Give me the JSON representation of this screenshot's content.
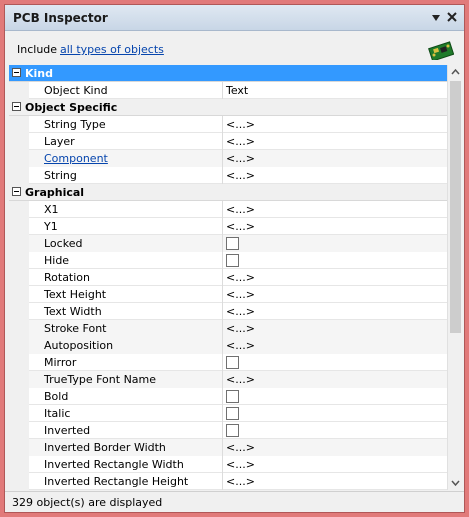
{
  "window": {
    "title": "PCB Inspector"
  },
  "include": {
    "label": "Include",
    "link": "all types of objects"
  },
  "categories": {
    "kind": {
      "label": "Kind"
    },
    "object_specific": {
      "label": "Object Specific"
    },
    "graphical": {
      "label": "Graphical"
    }
  },
  "kind_props": [
    {
      "name": "Object Kind",
      "value": "Text"
    }
  ],
  "object_specific_props": [
    {
      "name": "String Type",
      "value": "<...>"
    },
    {
      "name": "Layer",
      "value": "<...>"
    },
    {
      "name": "Component",
      "value": "<...>"
    },
    {
      "name": "String",
      "value": "<...>"
    }
  ],
  "graphical_props": [
    {
      "name": "X1",
      "value": "<...>"
    },
    {
      "name": "Y1",
      "value": "<...>"
    },
    {
      "name": "Locked",
      "value": null
    },
    {
      "name": "Hide",
      "value": null
    },
    {
      "name": "Rotation",
      "value": "<...>"
    },
    {
      "name": "Text Height",
      "value": "<...>"
    },
    {
      "name": "Text Width",
      "value": "<...>"
    },
    {
      "name": "Stroke Font",
      "value": "<...>"
    },
    {
      "name": "Autoposition",
      "value": "<...>"
    },
    {
      "name": "Mirror",
      "value": null
    },
    {
      "name": "TrueType Font Name",
      "value": "<...>"
    },
    {
      "name": "Bold",
      "value": null
    },
    {
      "name": "Italic",
      "value": null
    },
    {
      "name": "Inverted",
      "value": null
    },
    {
      "name": "Inverted Border Width",
      "value": "<...>"
    },
    {
      "name": "Inverted Rectangle Width",
      "value": "<...>"
    },
    {
      "name": "Inverted Rectangle Height",
      "value": "<...>"
    }
  ],
  "status": {
    "text": "329 object(s) are displayed"
  },
  "colors": {
    "selection": "#3399ff",
    "link": "#0645ad",
    "frame": "#e17a7a"
  },
  "icons": {
    "pin": "pin-dropdown-icon",
    "close": "close-icon",
    "pcb": "pcb-board-icon"
  }
}
